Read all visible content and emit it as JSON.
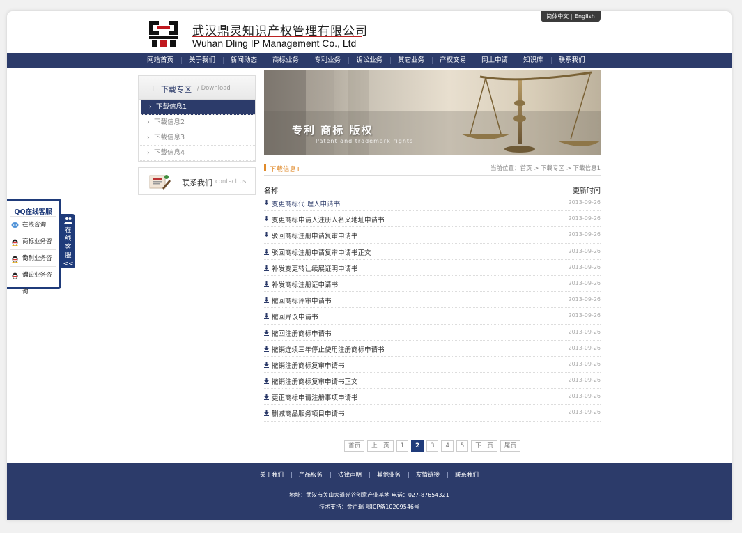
{
  "header": {
    "company_cn": "武汉鼎灵知识产权管理有限公司",
    "company_en": "Wuhan Dling IP Management Co., Ltd",
    "lang_cn": "简体中文",
    "lang_sep": "|",
    "lang_en": "English"
  },
  "nav": [
    "网站首页",
    "关于我们",
    "新闻动态",
    "商标业务",
    "专利业务",
    "诉讼业务",
    "其它业务",
    "产权交易",
    "网上申请",
    "知识库",
    "联系我们"
  ],
  "sidebar": {
    "plus": "+",
    "title": "下载专区",
    "title_en": "/ Download",
    "items": [
      "下载信息1",
      "下载信息2",
      "下载信息3",
      "下载信息4"
    ],
    "contact_title": "联系我们",
    "contact_en": "contact us"
  },
  "banner": {
    "title": "专利 商标 版权",
    "subtitle": "Patent and trademark rights"
  },
  "content": {
    "current": "下载信息1",
    "breadcrumb": "当前位置：首页 > 下载专区 > 下载信息1",
    "col_name": "名称",
    "col_date": "更新时间",
    "rows": [
      {
        "name": "变更商标代  理人申请书",
        "date": "2013-09-26"
      },
      {
        "name": "变更商标申请人注册人名义地址申请书",
        "date": "2013-09-26"
      },
      {
        "name": "驳回商标注册申请复审申请书",
        "date": "2013-09-26"
      },
      {
        "name": "驳回商标注册申请复审申请书正文",
        "date": "2013-09-26"
      },
      {
        "name": "补发变更转让续展证明申请书",
        "date": "2013-09-26"
      },
      {
        "name": "补发商标注册证申请书",
        "date": "2013-09-26"
      },
      {
        "name": "撤回商标评审申请书",
        "date": "2013-09-26"
      },
      {
        "name": "撤回异议申请书",
        "date": "2013-09-26"
      },
      {
        "name": "撤回注册商标申请书",
        "date": "2013-09-26"
      },
      {
        "name": "撤销连续三年停止使用注册商标申请书",
        "date": "2013-09-26"
      },
      {
        "name": "撤销注册商标复审申请书",
        "date": "2013-09-26"
      },
      {
        "name": "撤销注册商标复审申请书正文",
        "date": "2013-09-26"
      },
      {
        "name": "更正商标申请注册事项申请书",
        "date": "2013-09-26"
      },
      {
        "name": "删减商品服务项目申请书",
        "date": "2013-09-26"
      }
    ]
  },
  "pager": {
    "first": "首页",
    "prev": "上一页",
    "pages": [
      "1",
      "2",
      "3",
      "4",
      "5"
    ],
    "current_page": "2",
    "next": "下一页",
    "last": "尾页"
  },
  "footer": {
    "links": [
      "关于我们",
      "产品服务",
      "法律声明",
      "其他业务",
      "友情链接",
      "联系我们"
    ],
    "address_line": "地址：武汉市关山大道光谷创意产业基地    电话：027-87654321",
    "support_line": "技术支持：金百瑞    鄂ICP备10209546号"
  },
  "qq": {
    "title": "QQ在线客服",
    "items": [
      "在线咨询",
      "商标业务咨询",
      "专利业务咨询",
      "诉讼业务咨询"
    ],
    "tab_text": [
      "在",
      "线",
      "客",
      "服",
      "<<"
    ]
  },
  "colors": {
    "navy": "#2c3b6a",
    "accent_orange": "#e08a2a"
  }
}
